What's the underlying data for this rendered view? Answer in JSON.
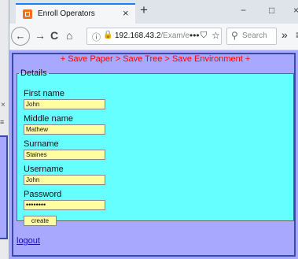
{
  "browser": {
    "tab_title": "Enroll Operators",
    "tab_close": "×",
    "new_tab": "+",
    "minimize": "−",
    "maximize": "□",
    "close": "×",
    "back": "←",
    "forward": "→",
    "reload": "C",
    "home": "⌂",
    "url_info": "ⓘ",
    "url_host": "192.168.43.2",
    "url_path": "/Exam/e",
    "page_actions": "•••",
    "pocket": "⛉",
    "bookmark": "☆",
    "search_placeholder": "Search",
    "overflow": "»",
    "menu": "≡"
  },
  "background_window": {
    "close": "×",
    "menu": "≡"
  },
  "page": {
    "slogan": "+ Save Paper > Save Tree > Save Environment +",
    "legend": "Details",
    "fields": [
      {
        "label": "First name",
        "value": "John"
      },
      {
        "label": "Middle name",
        "value": "Mathew"
      },
      {
        "label": "Surname",
        "value": "Staines"
      },
      {
        "label": "Username",
        "value": "John"
      },
      {
        "label": "Password",
        "value": "••••••••"
      }
    ],
    "create_label": "create",
    "logout_label": "logout"
  }
}
